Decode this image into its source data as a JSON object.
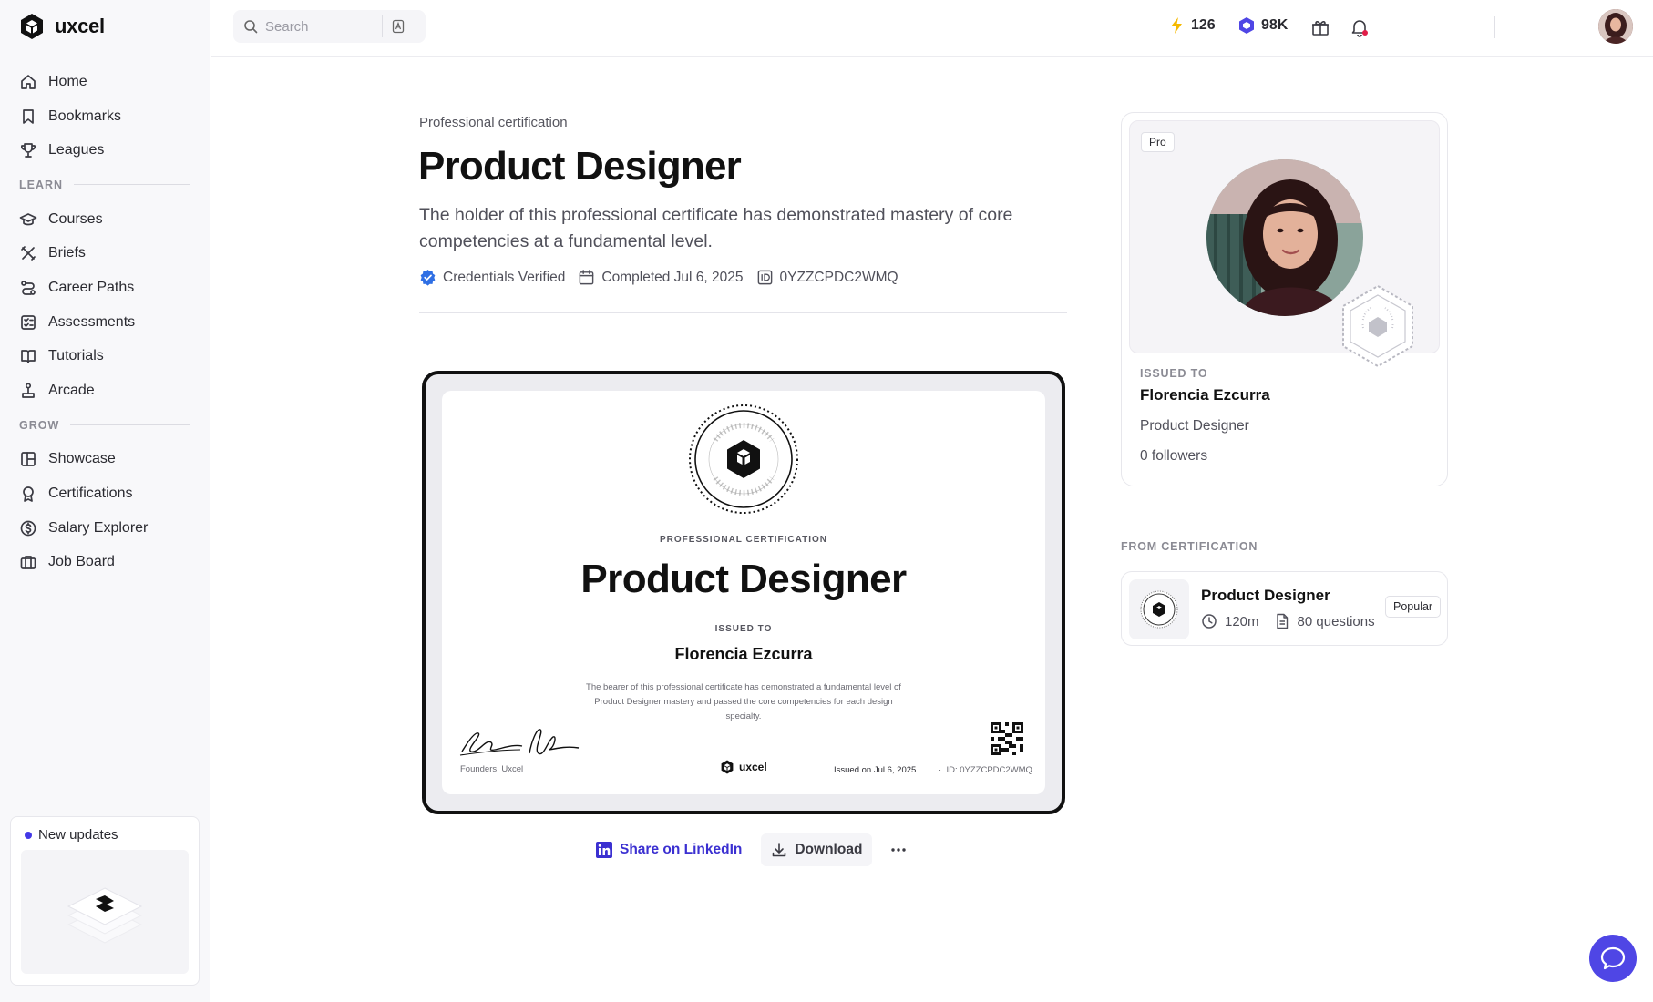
{
  "brand": {
    "name": "uxcel"
  },
  "sidebar": {
    "items": [
      {
        "label": "Home"
      },
      {
        "label": "Bookmarks"
      },
      {
        "label": "Leagues"
      }
    ],
    "learn_label": "LEARN",
    "learn_items": [
      {
        "label": "Courses"
      },
      {
        "label": "Briefs"
      },
      {
        "label": "Career Paths"
      },
      {
        "label": "Assessments"
      },
      {
        "label": "Tutorials"
      },
      {
        "label": "Arcade"
      }
    ],
    "grow_label": "GROW",
    "grow_items": [
      {
        "label": "Showcase"
      },
      {
        "label": "Certifications"
      },
      {
        "label": "Salary Explorer"
      },
      {
        "label": "Job Board"
      }
    ],
    "updates_label": "New updates"
  },
  "topbar": {
    "search_placeholder": "Search",
    "streak": "126",
    "xp": "98K"
  },
  "main": {
    "eyebrow": "Professional certification",
    "title": "Product Designer",
    "description": "The holder of this professional certificate has demonstrated mastery of core competencies at a fundamental level.",
    "verified": "Credentials Verified",
    "completed": "Completed Jul 6, 2025",
    "credential_id": "0YZZCPDC2WMQ"
  },
  "certificate": {
    "eyebrow": "PROFESSIONAL CERTIFICATION",
    "title": "Product Designer",
    "issued_to_label": "ISSUED TO",
    "name": "Florencia Ezcurra",
    "body": "The bearer of this professional certificate has demonstrated a fundamental level of Product Designer mastery and passed the core competencies for each design specialty.",
    "founders": "Founders, Uxcel",
    "brand": "uxcel",
    "issued_on": "Issued on Jul 6, 2025",
    "separator": "·",
    "id": "ID: 0YZZCPDC2WMQ"
  },
  "actions": {
    "linkedin": "Share on LinkedIn",
    "download": "Download"
  },
  "profile_card": {
    "tag": "Pro",
    "issued_label": "ISSUED TO",
    "name": "Florencia Ezcurra",
    "role": "Product Designer",
    "followers": "0 followers"
  },
  "from_certification": {
    "label": "FROM CERTIFICATION",
    "title": "Product Designer",
    "duration": "120m",
    "questions": "80 questions",
    "badge": "Popular"
  },
  "colors": {
    "accent": "#4f46e5",
    "link": "#3b30d1",
    "streak": "#f5b900",
    "verified": "#2f6fe4"
  }
}
